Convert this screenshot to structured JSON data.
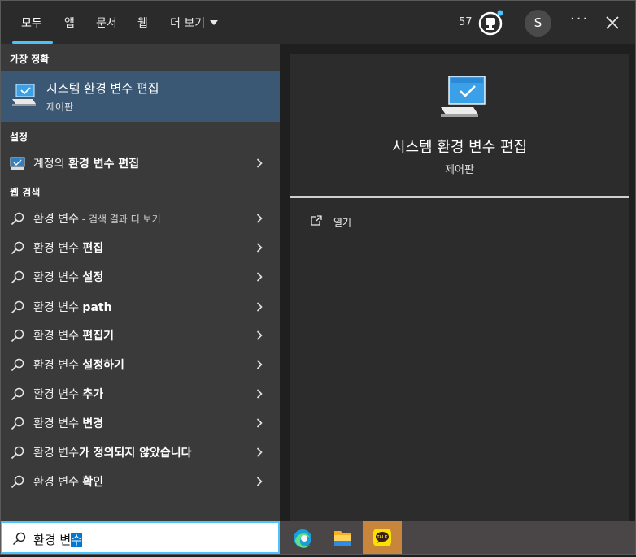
{
  "tabs": [
    {
      "label": "모두",
      "active": true
    },
    {
      "label": "앱"
    },
    {
      "label": "문서"
    },
    {
      "label": "웹"
    },
    {
      "label": "더 보기"
    }
  ],
  "header": {
    "points": "57",
    "avatar_initial": "S",
    "more_label": "···"
  },
  "sections": {
    "best_match": "가장 정확",
    "settings": "설정",
    "web_search": "웹 검색"
  },
  "best_match": {
    "title": "시스템 환경 변수 편집",
    "subtitle": "제어판"
  },
  "settings_item": {
    "prefix": "계정의 ",
    "bold": "환경 변수 편집",
    "icon": "monitor-icon"
  },
  "web_results": [
    {
      "prefix": "환경 변수",
      "bold": "",
      "small": " - 검색 결과 더 보기"
    },
    {
      "prefix": "환경 변수 ",
      "bold": "편집",
      "small": ""
    },
    {
      "prefix": "환경 변수 ",
      "bold": "설정",
      "small": ""
    },
    {
      "prefix": "환경 변수 ",
      "bold": "path",
      "small": ""
    },
    {
      "prefix": "환경 변수 ",
      "bold": "편집기",
      "small": ""
    },
    {
      "prefix": "환경 변수 ",
      "bold": "설정하기",
      "small": ""
    },
    {
      "prefix": "환경 변수 ",
      "bold": "추가",
      "small": ""
    },
    {
      "prefix": "환경 변수 ",
      "bold": "변경",
      "small": ""
    },
    {
      "prefix": "환경 변수",
      "bold": "가 정의되지 않았습니다",
      "small": ""
    },
    {
      "prefix": "환경 변수 ",
      "bold": "확인",
      "small": ""
    }
  ],
  "preview": {
    "title": "시스템 환경 변수 편집",
    "subtitle": "제어판",
    "open_label": "열기"
  },
  "search": {
    "typed": "환경 변",
    "composing": "수"
  },
  "taskbar": [
    {
      "name": "edge-icon"
    },
    {
      "name": "file-explorer-icon"
    },
    {
      "name": "kakaotalk-icon",
      "label": "TALK"
    }
  ],
  "colors": {
    "accent": "#4cc2ff",
    "selected_row": "#3a5873",
    "selection": "#0078d4"
  }
}
